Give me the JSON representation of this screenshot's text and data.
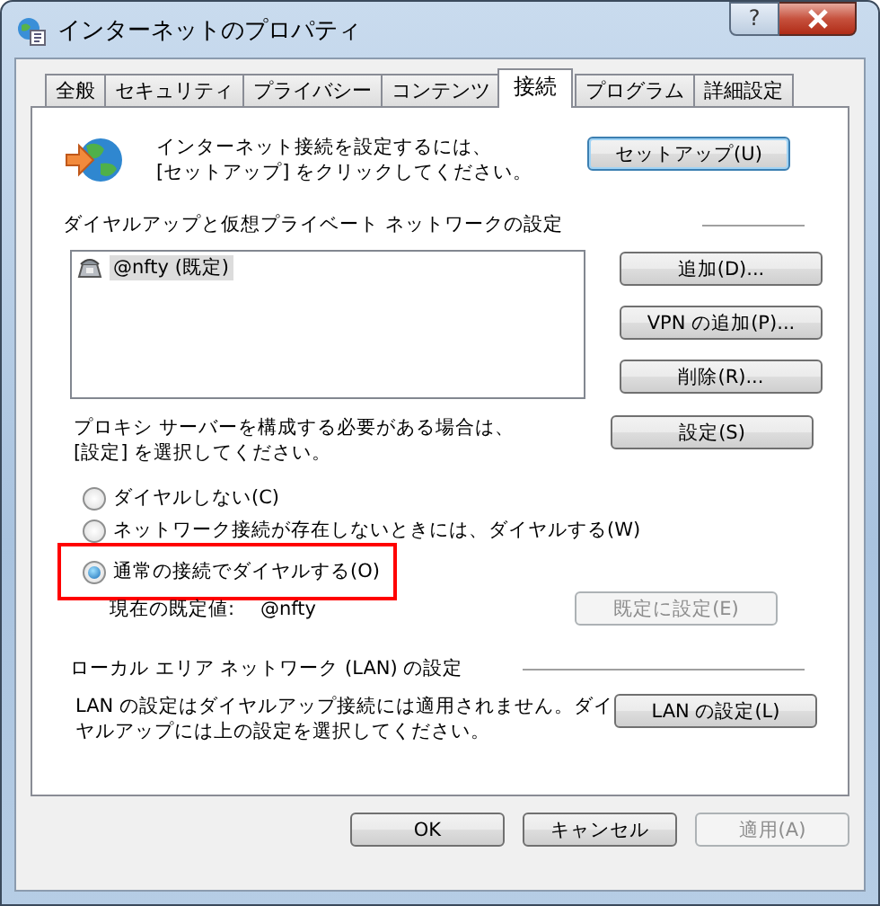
{
  "window": {
    "title": "インターネットのプロパティ",
    "help_button": "?"
  },
  "tabs": [
    {
      "label": "全般",
      "selected": false
    },
    {
      "label": "セキュリティ",
      "selected": false
    },
    {
      "label": "プライバシー",
      "selected": false
    },
    {
      "label": "コンテンツ",
      "selected": false
    },
    {
      "label": "接続",
      "selected": true
    },
    {
      "label": "プログラム",
      "selected": false
    },
    {
      "label": "詳細設定",
      "selected": false
    }
  ],
  "setup": {
    "text_lines": [
      "インターネット接続を設定するには、",
      "[セットアップ] をクリックしてください。"
    ],
    "button": "セットアップ(U)"
  },
  "dialup": {
    "heading": "ダイヤルアップと仮想プライベート ネットワークの設定",
    "connections": [
      {
        "name": "@nfty (既定)",
        "selected": true
      }
    ],
    "buttons": [
      {
        "label": "追加(D)...",
        "disabled": false
      },
      {
        "label": "VPN の追加(P)...",
        "disabled": false
      },
      {
        "label": "削除(R)...",
        "disabled": false
      }
    ]
  },
  "proxy": {
    "text_lines": [
      "プロキシ サーバーを構成する必要がある場合は、",
      "[設定] を選択してください。"
    ],
    "button": "設定(S)"
  },
  "dial_options": [
    {
      "label": "ダイヤルしない(C)",
      "selected": false,
      "highlighted": false
    },
    {
      "label": "ネットワーク接続が存在しないときには、ダイヤルする(W)",
      "selected": false,
      "highlighted": false
    },
    {
      "label": "通常の接続でダイヤルする(O)",
      "selected": true,
      "highlighted": true
    }
  ],
  "current_default": {
    "label": "現在の既定値:",
    "value": "@nfty",
    "button": {
      "label": "既定に設定(E)",
      "disabled": true
    }
  },
  "lan": {
    "heading": "ローカル エリア ネットワーク (LAN) の設定",
    "text_lines": [
      "LAN の設定はダイヤルアップ接続には適用されません。ダイ",
      "ヤルアップには上の設定を選択してください。"
    ],
    "button": "LAN の設定(L)"
  },
  "footer_buttons": [
    {
      "label": "OK",
      "disabled": false
    },
    {
      "label": "キャンセル",
      "disabled": false
    },
    {
      "label": "適用(A)",
      "disabled": true
    }
  ]
}
